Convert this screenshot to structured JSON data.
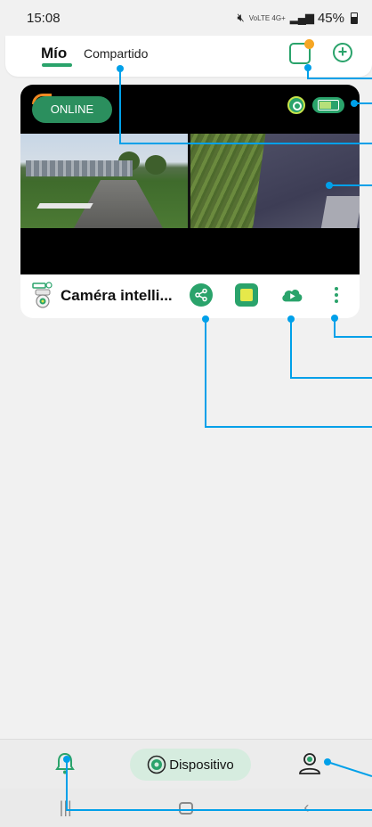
{
  "status_bar": {
    "time": "15:08",
    "network": "VoLTE 4G+",
    "battery": "45%"
  },
  "header": {
    "tab_mine": "Mío",
    "tab_shared": "Compartido"
  },
  "device_card": {
    "status_badge": "ONLINE",
    "device_name": "Caméra intelli...",
    "battery_level": 0.6
  },
  "bottom_nav": {
    "device_tab": "Dispositivo"
  },
  "colors": {
    "accent": "#2aa36b",
    "online": "#2b8f5e",
    "notification_dot": "#f6a623",
    "annotation": "#00a0e9"
  },
  "icons": [
    "message-icon",
    "add-icon",
    "camera-status-icon",
    "battery-icon",
    "device-camera-icon",
    "share-icon",
    "sd-card-icon",
    "cloud-playback-icon",
    "more-icon",
    "alerts-bell-icon",
    "device-tab-icon",
    "profile-icon",
    "recent-apps-icon",
    "home-icon",
    "back-icon"
  ]
}
